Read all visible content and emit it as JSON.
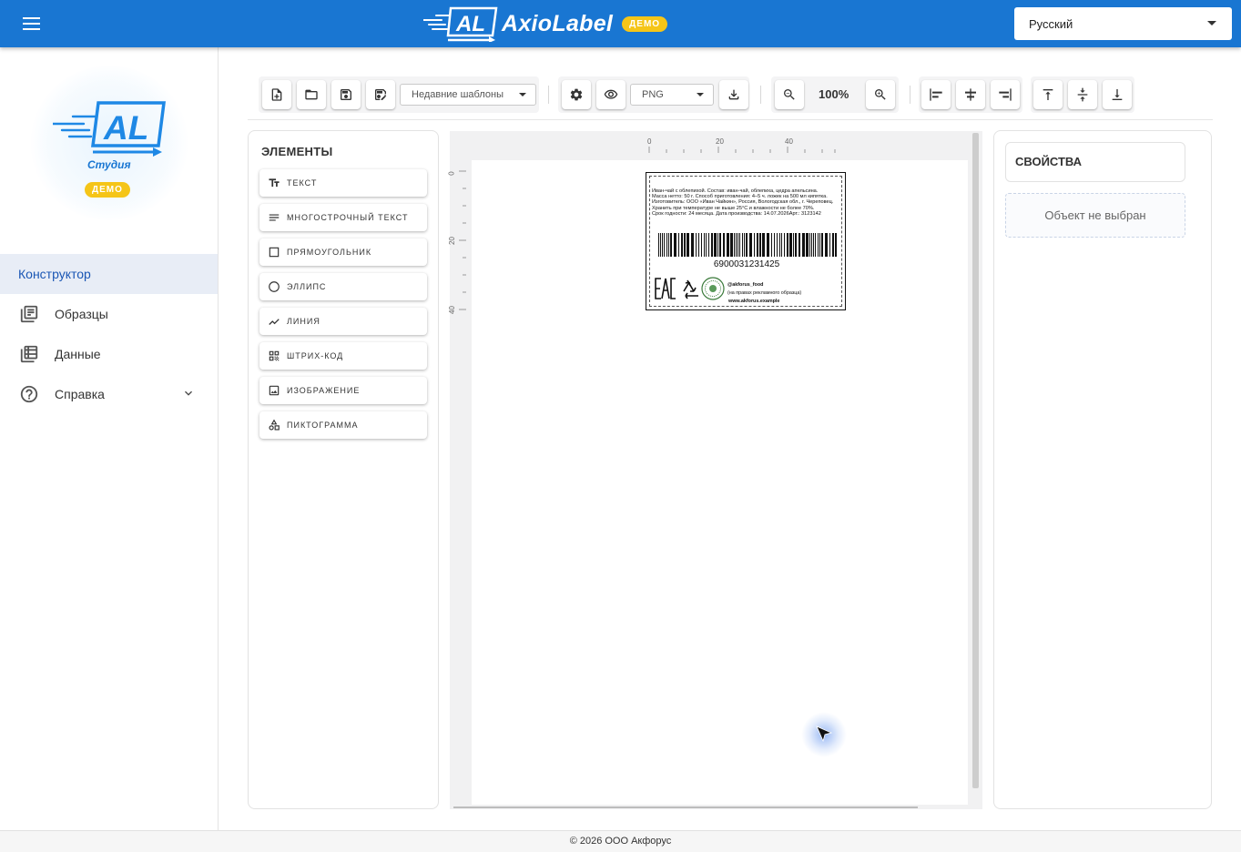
{
  "app": {
    "name": "AxioLabel",
    "demo_badge": "ДЕМО",
    "language": "Русский"
  },
  "sidebar": {
    "studio_label": "Студия",
    "demo_badge": "ДЕМО",
    "items": [
      {
        "label": "Конструктор",
        "icon": "none",
        "active": true
      },
      {
        "label": "Образцы",
        "icon": "library-icon"
      },
      {
        "label": "Данные",
        "icon": "table-icon"
      },
      {
        "label": "Справка",
        "icon": "help-icon",
        "expandable": true
      }
    ]
  },
  "toolbar": {
    "recent_templates_placeholder": "Недавние шаблоны",
    "export_format": "PNG",
    "zoom": "100%"
  },
  "elements_panel": {
    "title": "ЭЛЕМЕНТЫ",
    "items": [
      {
        "label": "текст",
        "icon": "text-icon"
      },
      {
        "label": "многострочный текст",
        "icon": "multiline-text-icon"
      },
      {
        "label": "прямоугольник",
        "icon": "rectangle-icon"
      },
      {
        "label": "эллипс",
        "icon": "ellipse-icon"
      },
      {
        "label": "линия",
        "icon": "line-icon"
      },
      {
        "label": "штрих-код",
        "icon": "qr-icon"
      },
      {
        "label": "изображение",
        "icon": "image-icon"
      },
      {
        "label": "пиктограмма",
        "icon": "shapes-icon"
      }
    ]
  },
  "canvas": {
    "ruler_top_labels": [
      "0",
      "20",
      "40"
    ],
    "ruler_left_labels": [
      "0",
      "20",
      "40"
    ],
    "label": {
      "text_lines": [
        "Иван-чай с облепихой. Состав: иван-чай, облепиха, цедра апельсина.",
        "Масса нетто: 50 г. Способ приготовления: 4–5 ч. ложек на 500 мл кипятка.",
        "Изготовитель: ООО «Иван Чайкин», Россия, Вологодская обл., г. Череповец.",
        "Хранить при температуре не выше 25°C и влажности не более 70%.",
        "Срок годности: 24 месяца. Дата производства: 14.07.2026Арт.: 3123142"
      ],
      "barcode_number": "6900031231425",
      "social": "@akforus_food",
      "social_note": "(на правах рекламного образца)",
      "website": "www.akforus.example",
      "marks": [
        "eac-mark-icon",
        "recycle-icon",
        "seal-icon"
      ]
    }
  },
  "properties_panel": {
    "title": "СВОЙСТВА",
    "empty_text": "Объект не выбран"
  },
  "footer": {
    "text": "© 2026 ООО Акфорус"
  },
  "colors": {
    "primary": "#1976d2",
    "demo_badge": "#f5c518",
    "active_nav_text": "#1a56b4"
  }
}
